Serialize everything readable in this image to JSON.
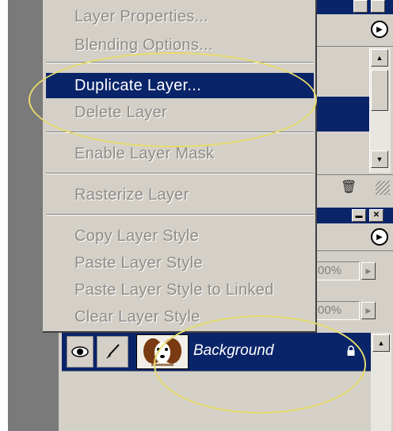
{
  "context_menu": {
    "items": [
      {
        "label": "Layer Properties...",
        "enabled": false
      },
      {
        "label": "Blending Options...",
        "enabled": false
      },
      {
        "label": "Duplicate Layer...",
        "enabled": true,
        "highlighted": true
      },
      {
        "label": "Delete Layer",
        "enabled": false
      },
      {
        "label": "Enable Layer Mask",
        "enabled": false
      },
      {
        "label": "Rasterize Layer",
        "enabled": false
      },
      {
        "label": "Copy Layer Style",
        "enabled": false
      },
      {
        "label": "Paste Layer Style",
        "enabled": false
      },
      {
        "label": "Paste Layer Style to Linked",
        "enabled": false
      },
      {
        "label": "Clear Layer Style",
        "enabled": false
      }
    ]
  },
  "layers_panel": {
    "opacity_value": "00%",
    "fill_value": "00%",
    "layer": {
      "name": "Background",
      "visible": true,
      "locked": true
    }
  },
  "colors": {
    "selection": "#0a246a",
    "panel": "#d4d0c8",
    "annotation": "#e6dc6a",
    "disabled_text": "#8e8c88"
  }
}
